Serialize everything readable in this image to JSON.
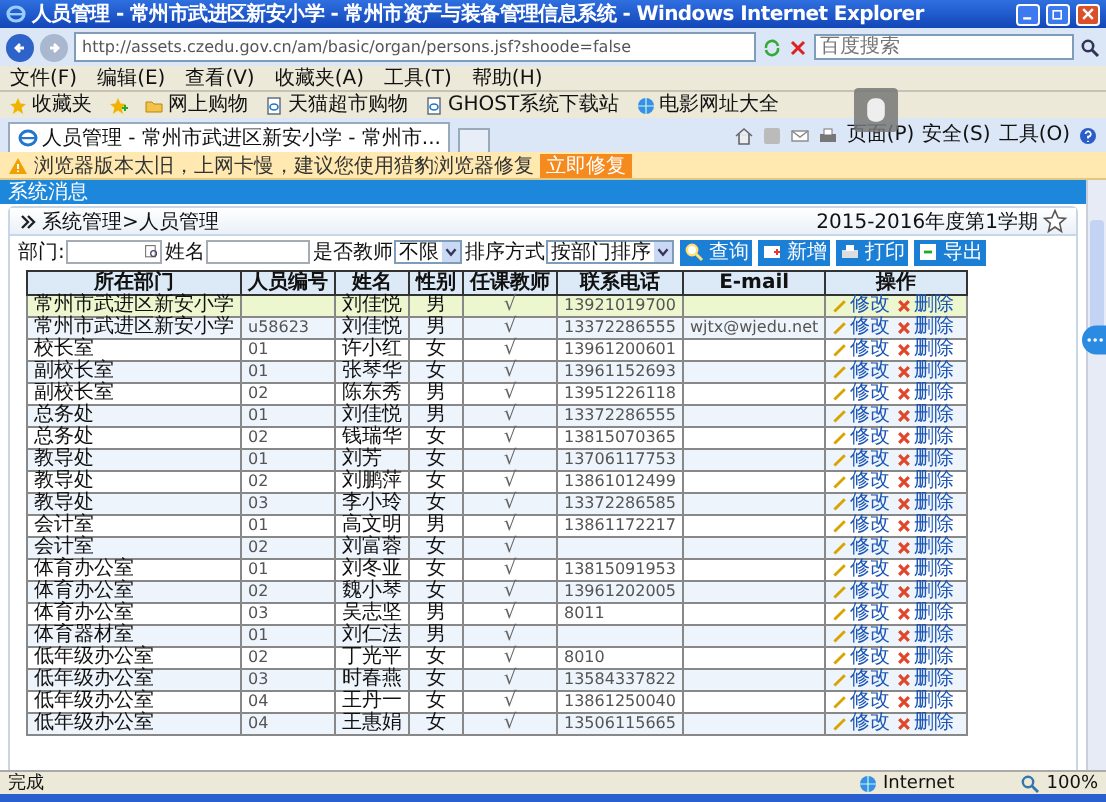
{
  "window": {
    "title": "人员管理 - 常州市武进区新安小学 - 常州市资产与装备管理信息系统 - Windows Internet Explorer"
  },
  "address_bar": {
    "url": "http://assets.czedu.gov.cn/am/basic/organ/persons.jsf?shoode=false",
    "search_placeholder": "百度搜索"
  },
  "menu": [
    "文件(F)",
    "编辑(E)",
    "查看(V)",
    "收藏夹(A)",
    "工具(T)",
    "帮助(H)"
  ],
  "favorites_bar": {
    "label": "收藏夹",
    "links": [
      {
        "label": "网上购物",
        "kind": "folder"
      },
      {
        "label": "天猫超市购物",
        "kind": "page"
      },
      {
        "label": "GHOST系统下载站",
        "kind": "page"
      },
      {
        "label": "电影网址大全",
        "kind": "globe"
      }
    ]
  },
  "tabs": [
    {
      "label": "人员管理 - 常州市武进区新安小学 - 常州市...",
      "selected": true
    }
  ],
  "commands": [
    "页面(P)",
    "安全(S)",
    "工具(O)"
  ],
  "info_bar": {
    "message": "浏览器版本太旧，上网卡慢，建议您使用猎豹浏览器修复",
    "button": "立即修复"
  },
  "page": {
    "header": "系统消息",
    "breadcrumb": "系统管理>人员管理",
    "term": "2015-2016年度第1学期",
    "filters": [
      {
        "kind": "picker",
        "label": "部门:"
      },
      {
        "kind": "input",
        "label": "姓名"
      },
      {
        "kind": "select",
        "label": "是否教师",
        "value": "不限"
      },
      {
        "kind": "select",
        "label": "排序方式",
        "value": "按部门排序"
      }
    ],
    "buttons": [
      {
        "kind": "search",
        "label": "查询"
      },
      {
        "kind": "add",
        "label": "新增"
      },
      {
        "kind": "print",
        "label": "打印"
      },
      {
        "kind": "export",
        "label": "导出"
      }
    ]
  },
  "table": {
    "columns": [
      "所在部门",
      "人员编号",
      "姓名",
      "性别",
      "任课教师",
      "联系电话",
      "E-mail",
      "操作"
    ],
    "rows": [
      {
        "dept": "常州市武进区新安小学",
        "name": "刘佳悦",
        "gender": "男",
        "teacher": "√",
        "phone": "13921019700",
        "actions": [
          "修改",
          "删除"
        ],
        "selected": true
      },
      {
        "dept": "常州市武进区新安小学",
        "id": "u58623",
        "name": "刘佳悦",
        "gender": "男",
        "teacher": "√",
        "phone": "13372286555",
        "email": "wjtx@wjedu.net",
        "actions": [
          "修改",
          "删除"
        ],
        "selected": false
      },
      {
        "dept": "校长室",
        "id": "01",
        "name": "许小红",
        "gender": "女",
        "teacher": "√",
        "phone": "13961200601",
        "actions": [
          "修改",
          "删除"
        ],
        "selected": false
      },
      {
        "dept": "副校长室",
        "id": "01",
        "name": "张琴华",
        "gender": "女",
        "teacher": "√",
        "phone": "13961152693",
        "actions": [
          "修改",
          "删除"
        ],
        "selected": false
      },
      {
        "dept": "副校长室",
        "id": "02",
        "name": "陈东秀",
        "gender": "男",
        "teacher": "√",
        "phone": "13951226118",
        "actions": [
          "修改",
          "删除"
        ],
        "selected": false
      },
      {
        "dept": "总务处",
        "id": "01",
        "name": "刘佳悦",
        "gender": "男",
        "teacher": "√",
        "phone": "13372286555",
        "actions": [
          "修改",
          "删除"
        ],
        "selected": false
      },
      {
        "dept": "总务处",
        "id": "02",
        "name": "钱瑞华",
        "gender": "女",
        "teacher": "√",
        "phone": "13815070365",
        "actions": [
          "修改",
          "删除"
        ],
        "selected": false
      },
      {
        "dept": "教导处",
        "id": "01",
        "name": "刘芳",
        "gender": "女",
        "teacher": "√",
        "phone": "13706117753",
        "actions": [
          "修改",
          "删除"
        ],
        "selected": false
      },
      {
        "dept": "教导处",
        "id": "02",
        "name": "刘鹏萍",
        "gender": "女",
        "teacher": "√",
        "phone": "13861012499",
        "actions": [
          "修改",
          "删除"
        ],
        "selected": false
      },
      {
        "dept": "教导处",
        "id": "03",
        "name": "李小玲",
        "gender": "女",
        "teacher": "√",
        "phone": "13372286585",
        "actions": [
          "修改",
          "删除"
        ],
        "selected": false
      },
      {
        "dept": "会计室",
        "id": "01",
        "name": "高文明",
        "gender": "男",
        "teacher": "√",
        "phone": "13861172217",
        "actions": [
          "修改",
          "删除"
        ],
        "selected": false
      },
      {
        "dept": "会计室",
        "id": "02",
        "name": "刘富蓉",
        "gender": "女",
        "teacher": "√",
        "actions": [
          "修改",
          "删除"
        ],
        "selected": false
      },
      {
        "dept": "体育办公室",
        "id": "01",
        "name": "刘冬亚",
        "gender": "女",
        "teacher": "√",
        "phone": "13815091953",
        "actions": [
          "修改",
          "删除"
        ],
        "selected": false
      },
      {
        "dept": "体育办公室",
        "id": "02",
        "name": "魏小琴",
        "gender": "女",
        "teacher": "√",
        "phone": "13961202005",
        "actions": [
          "修改",
          "删除"
        ],
        "selected": false
      },
      {
        "dept": "体育办公室",
        "id": "03",
        "name": "吴志坚",
        "gender": "男",
        "teacher": "√",
        "phone": "8011",
        "actions": [
          "修改",
          "删除"
        ],
        "selected": false
      },
      {
        "dept": "体育器材室",
        "id": "01",
        "name": "刘仁法",
        "gender": "男",
        "teacher": "√",
        "actions": [
          "修改",
          "删除"
        ],
        "selected": false
      },
      {
        "dept": "低年级办公室",
        "id": "02",
        "name": "丁光平",
        "gender": "女",
        "teacher": "√",
        "phone": "8010",
        "actions": [
          "修改",
          "删除"
        ],
        "selected": false
      },
      {
        "dept": "低年级办公室",
        "id": "03",
        "name": "时春燕",
        "gender": "女",
        "teacher": "√",
        "phone": "13584337822",
        "actions": [
          "修改",
          "删除"
        ],
        "selected": false
      },
      {
        "dept": "低年级办公室",
        "id": "04",
        "name": "王丹一",
        "gender": "女",
        "teacher": "√",
        "phone": "13861250040",
        "actions": [
          "修改",
          "删除"
        ],
        "selected": false
      },
      {
        "dept": "低年级办公室",
        "id": "04",
        "name": "王惠娟",
        "gender": "女",
        "teacher": "√",
        "phone": "13506115665",
        "actions": [
          "修改",
          "删除"
        ],
        "selected": false
      }
    ]
  },
  "status_bar": {
    "text": "完成",
    "zone": "Internet",
    "zoom": "100%"
  }
}
